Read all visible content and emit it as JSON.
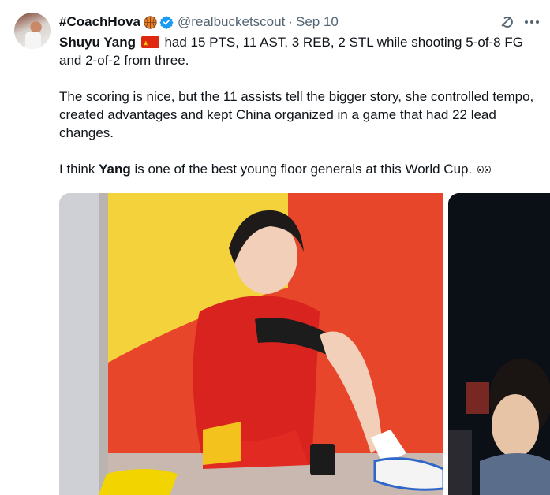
{
  "tweet": {
    "display_name": "#CoachHova",
    "name_emoji_icon": "basketball-icon",
    "verified_icon": "verified-badge-icon",
    "handle": "@realbucketscout",
    "separator": "·",
    "date": "Sep 10",
    "actions": {
      "grok_icon": "grok-icon",
      "more_icon": "more-options-icon"
    },
    "line1": {
      "name": "Shuyu Yang",
      "flag_icon": "china-flag-icon",
      "stats": " had 15 PTS, 11 AST, 3 REB, 2 STL while shooting 5-of-8 FG and 2-of-2 from three."
    },
    "paragraph2": "The scoring is nice, but the 11 assists tell the bigger story, she controlled tempo, created advantages and kept China organized in a game that had 22 lead changes.",
    "paragraph3": {
      "before": "I think ",
      "bold": "Yang",
      "after": " is one of the best young floor generals at this World Cup. ",
      "emoji_icon": "eyes-icon"
    }
  },
  "media": [
    {
      "icon": "photo-player-seated-icon"
    },
    {
      "icon": "photo-crowd-icon"
    }
  ],
  "colors": {
    "text": "#0f1419",
    "muted": "#536471",
    "verified": "#1d9bf0",
    "flag_red": "#de2910"
  }
}
